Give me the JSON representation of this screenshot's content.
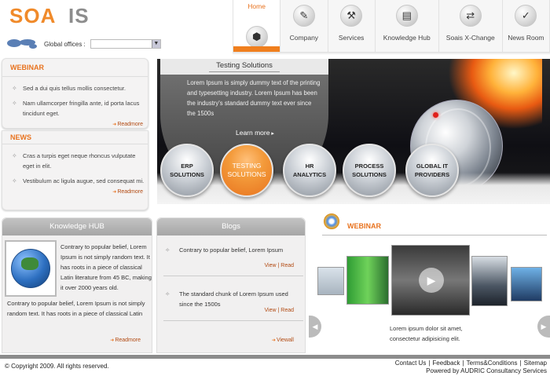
{
  "brand": {
    "logo_text": "SOAIS",
    "accent": "#e8731f"
  },
  "offices": {
    "label": "Global offices :",
    "value": ""
  },
  "nav": [
    {
      "label": "Home",
      "icon": "home-icon"
    },
    {
      "label": "Company",
      "icon": "company-icon"
    },
    {
      "label": "Services",
      "icon": "services-icon"
    },
    {
      "label": "Knowledge Hub",
      "icon": "knowledge-hub-icon"
    },
    {
      "label": "Soais X-Change",
      "icon": "xchange-icon"
    },
    {
      "label": "News Room",
      "icon": "news-room-icon"
    }
  ],
  "webinar_box": {
    "title": "WEBINAR",
    "items": [
      "Sed a dui quis tellus mollis consectetur.",
      "Nam ullamcorper fringilla ante, id porta lacus tincidunt eget."
    ],
    "readmore": "Readmore"
  },
  "news_box": {
    "title": "NEWS",
    "items": [
      "Cras a turpis eget neque rhoncus vulputate eget in elit.",
      "Vestibulum ac ligula augue, sed consequat mi."
    ],
    "readmore": "Readmore"
  },
  "banner": {
    "title": "Testing Solutions",
    "text": "Lorem Ipsum is simply dummy text of the printing and typesetting industry. Lorem Ipsum has been the industry's standard dummy text ever since the 1500s",
    "learn_more": "Learn more",
    "solutions": [
      "ERP SOLUTIONS",
      "TESTING SOLUTIONS",
      "HR ANALYTICS",
      "PROCESS SOLUTIONS",
      "GLOBAL IT PROVIDERS"
    ]
  },
  "knowledge_hub": {
    "title": "Knowledge HUB",
    "text1": "Contrary to popular belief, Lorem Ipsum is not simply random text. It has roots in a piece of classical Latin literature from 45 BC, making it over 2000 years old.",
    "text2": "Contrary to popular belief, Lorem Ipsum is not simply random text. It has roots in a piece of classical Latin",
    "readmore": "Readmore"
  },
  "blogs": {
    "title": "Blogs",
    "items": [
      {
        "text": "Contrary to popular belief, Lorem Ipsum",
        "view": "View",
        "read": "Read"
      },
      {
        "text": "The standard chunk of Lorem Ipsum used since the 1500s",
        "view": "View",
        "read": "Read"
      }
    ],
    "viewall": "Viewall"
  },
  "webinar_panel": {
    "title": "WEBINAR",
    "caption": "Lorem ipsum dolor sit amet, consectetur adipisicing elit."
  },
  "footer": {
    "copyright": "© Copyright 2009. All rights reserved.",
    "links": [
      "Contact Us",
      "Feedback",
      "Terms&Conditions",
      "Sitemap"
    ],
    "powered": "Powered by AUDRIC Consultancy Services"
  }
}
